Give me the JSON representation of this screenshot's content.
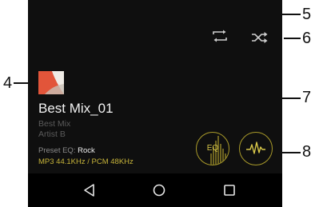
{
  "track": {
    "title": "Best Mix_01",
    "album": "Best Mix",
    "artist": "Artist B",
    "preset_eq_label": "Preset EQ:",
    "preset_eq_value": "Rock",
    "format_info": "MP3 44.1KHz / PCM 48KHz"
  },
  "controls": {
    "eq_label": "EQ"
  },
  "callouts": [
    "4",
    "5",
    "6",
    "7",
    "8"
  ],
  "colors": {
    "screen_bg": "#0f0f0f",
    "accent_gold": "#c7b43a",
    "album_art_red": "#e2553a"
  },
  "icons": {
    "repeat": "repeat-icon",
    "shuffle": "shuffle-icon",
    "back": "nav-back-icon",
    "home": "nav-home-icon",
    "recents": "nav-recents-icon",
    "waveform": "waveform-icon"
  }
}
